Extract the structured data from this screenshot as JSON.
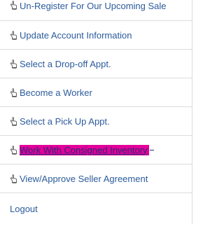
{
  "menu": {
    "items": [
      {
        "label": "Un-Register For Our Upcoming Sale",
        "icon": "pointing-hand-icon"
      },
      {
        "label": "Update Account Information",
        "icon": "pointing-hand-icon"
      },
      {
        "label": "Select a Drop-off Appt.",
        "icon": "pointing-hand-icon"
      },
      {
        "label": "Become a Worker",
        "icon": "pointing-hand-icon"
      },
      {
        "label": "Select a Pick Up Appt.",
        "icon": "pointing-hand-icon"
      },
      {
        "label": "Work With Consigned Inventory",
        "icon": "pointing-hand-icon",
        "highlighted": true
      },
      {
        "label": "View/Approve Seller Agreement",
        "icon": "pointing-hand-icon"
      },
      {
        "label": "Logout"
      }
    ]
  },
  "colors": {
    "link": "#2b5b9c",
    "highlight": "#e3009a",
    "border": "#dcdcdc"
  }
}
